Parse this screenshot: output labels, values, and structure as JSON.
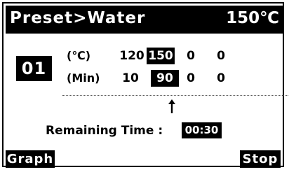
{
  "header": {
    "title": "Preset>Water",
    "temperature": "150℃"
  },
  "step": {
    "number": "01"
  },
  "rows": [
    {
      "label": "(℃)",
      "values": [
        "120",
        "150",
        "0",
        "0"
      ],
      "selected_index": 1
    },
    {
      "label": "(Min)",
      "values": [
        "10",
        "90",
        "0",
        "0"
      ],
      "selected_index": 1
    }
  ],
  "indicator": {
    "icon": "up-arrow-icon"
  },
  "remaining": {
    "label": "Remaining Time :",
    "value": "00:30"
  },
  "softkeys": {
    "left": "Graph",
    "right": "Stop"
  },
  "colors": {
    "foreground": "#000000",
    "background": "#ffffff"
  }
}
